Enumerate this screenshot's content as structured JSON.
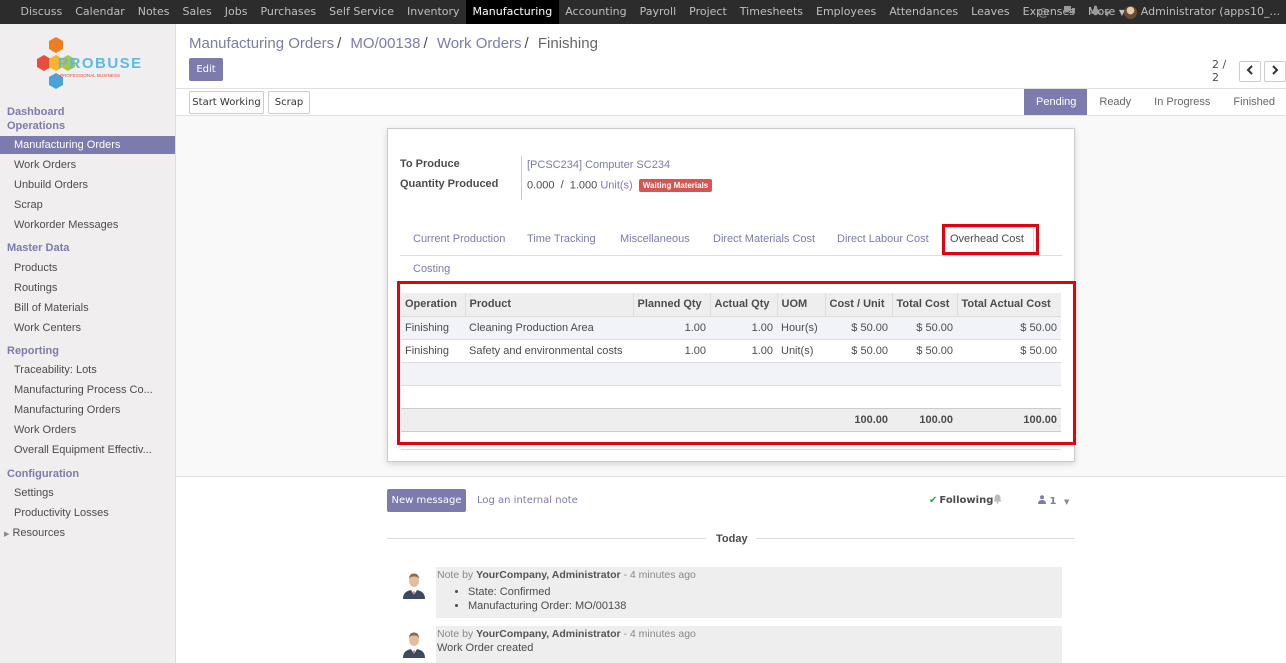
{
  "topnav": {
    "items": [
      "Discuss",
      "Calendar",
      "Notes",
      "Sales",
      "Jobs",
      "Purchases",
      "Self Service",
      "Inventory",
      "Manufacturing",
      "Accounting",
      "Payroll",
      "Project",
      "Timesheets",
      "Employees",
      "Attendances",
      "Leaves",
      "Expenses",
      "More"
    ],
    "active": "Manufacturing",
    "user": "Administrator (apps10_..."
  },
  "logo": {
    "text": "PROBUSE",
    "tagline": "PROFESSIONAL BUSINESS"
  },
  "sidebar": {
    "section_dashboard": "Dashboard",
    "section_operations": "Operations",
    "operations": [
      "Manufacturing Orders",
      "Work Orders",
      "Unbuild Orders",
      "Scrap",
      "Workorder Messages"
    ],
    "section_master": "Master Data",
    "master": [
      "Products",
      "Routings",
      "Bill of Materials",
      "Work Centers"
    ],
    "section_reporting": "Reporting",
    "reporting": [
      "Traceability: Lots",
      "Manufacturing Process Co...",
      "Manufacturing Orders",
      "Work Orders",
      "Overall Equipment Effectiv..."
    ],
    "section_config": "Configuration",
    "config": [
      "Settings",
      "Productivity Losses",
      "Resources"
    ]
  },
  "breadcrumb": {
    "b1": "Manufacturing Orders",
    "b2": "MO/00138",
    "b3": "Work Orders",
    "current": "Finishing"
  },
  "buttons": {
    "edit": "Edit",
    "start_working": "Start Working",
    "scrap": "Scrap",
    "new_message": "New message",
    "log_note": "Log an internal note"
  },
  "pager": {
    "count": "2 / 2"
  },
  "stages": [
    "Pending",
    "Ready",
    "In Progress",
    "Finished"
  ],
  "current_stage": "Pending",
  "form": {
    "to_produce_label": "To Produce",
    "to_produce_value": "[PCSC234] Computer SC234",
    "qty_label": "Quantity Produced",
    "qty_done": "0.000",
    "qty_sep": "/",
    "qty_total": "1.000",
    "qty_uom": "Unit(s)",
    "badge": "Waiting Materials"
  },
  "tabs": [
    "Current Production",
    "Time Tracking",
    "Miscellaneous",
    "Direct Materials Cost",
    "Direct Labour Cost",
    "Overhead Cost",
    "Costing"
  ],
  "active_tab": "Overhead Cost",
  "table": {
    "headers": [
      "Operation",
      "Product",
      "Planned Qty",
      "Actual Qty",
      "UOM",
      "Cost / Unit",
      "Total Cost",
      "Total Actual Cost"
    ],
    "rows": [
      [
        "Finishing",
        "Cleaning Production Area",
        "1.00",
        "1.00",
        "Hour(s)",
        "$ 50.00",
        "$ 50.00",
        "$ 50.00"
      ],
      [
        "Finishing",
        "Safety and environmental costs",
        "1.00",
        "1.00",
        "Unit(s)",
        "$ 50.00",
        "$ 50.00",
        "$ 50.00"
      ]
    ],
    "footer": {
      "cost_unit_total": "100.00",
      "total_cost": "100.00",
      "total_actual": "100.00"
    }
  },
  "chatter": {
    "following": "Following",
    "followers": "1",
    "today": "Today",
    "messages": [
      {
        "prefix": "Note by",
        "author": "YourCompany, Administrator",
        "time": "- 4 minutes ago",
        "items": [
          "State: Confirmed",
          "Manufacturing Order: MO/00138"
        ]
      },
      {
        "prefix": "Note by",
        "author": "YourCompany, Administrator",
        "time": "- 4 minutes ago",
        "body": "Work Order created"
      }
    ]
  },
  "colors": {
    "accent": "#7c7bad",
    "highlight": "#e3000f",
    "topbar": "#2c2c2c",
    "badge": "#d9534f"
  }
}
